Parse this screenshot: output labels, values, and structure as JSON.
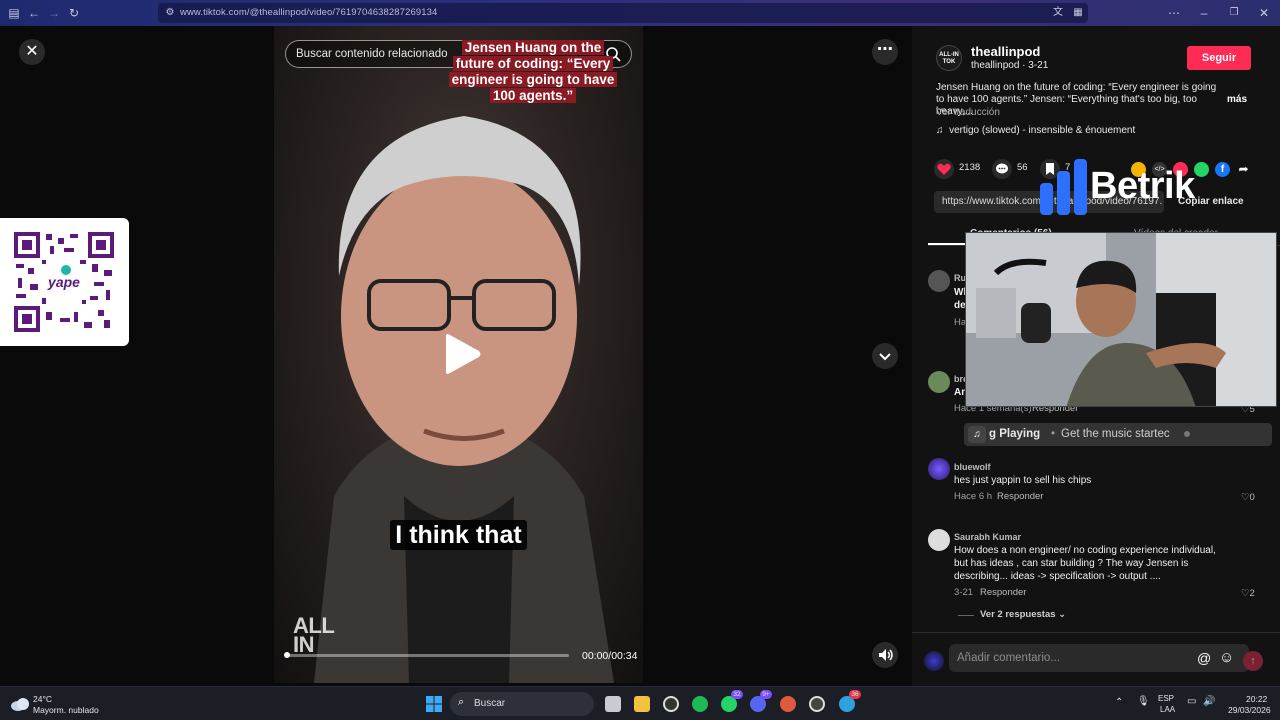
{
  "browser": {
    "url": "www.tiktok.com/@theallinpod/video/7619704638287269134"
  },
  "video": {
    "search_placeholder": "Buscar contenido relacionado",
    "top_caption": "Jensen Huang on the future of coding: “Every engineer is going to have 100 agents.”",
    "subtitle": "I think that",
    "watermark_line1": "ALL",
    "watermark_line2": "IN",
    "time": "00:00/00:34",
    "progress_fraction": 0.0
  },
  "author": {
    "avatar_line1": "ALL-IN",
    "avatar_line2": "TOK",
    "name": "theallinpod",
    "meta": "theallinpod · 3-21",
    "follow_label": "Seguir"
  },
  "description": {
    "text": "Jensen Huang on the future of coding: “Every engineer is going to have 100 agents.” Jensen: “Everything that's too big, too heavy,...",
    "more_label": "más",
    "translate_label": "Ver traducción",
    "music": "vertigo (slowed) - insensible & énouement"
  },
  "stats": {
    "likes": "2138",
    "comments": "56",
    "saves": "7"
  },
  "link": {
    "url": "https://www.tiktok.com/@theallinpod/video/76197...",
    "copy_label": "Copiar enlace"
  },
  "overlay": {
    "brand": "Betrik",
    "music_toast_prefix": "g Playing",
    "music_toast_text": "Get the music startec"
  },
  "tabs": {
    "comments": "Comentarios (56)",
    "creator": "Vídeos del creador"
  },
  "comments": [
    {
      "user": "Ru",
      "text": "Wh",
      "text2": "de",
      "meta": "Ha",
      "likes": ""
    },
    {
      "user": "bre",
      "text": "An",
      "meta": "Hace 1 semana(s)",
      "reply": "Responder",
      "likes": "5"
    },
    {
      "user": "bluewolf",
      "text": "hes just yappin to sell his chips",
      "meta": "Hace 6 h",
      "reply": "Responder",
      "likes": "0"
    },
    {
      "user": "Saurabh Kumar",
      "text": "How does a non engineer/ no coding experience individual, but has ideas , can star building ? The way Jensen is describing... ideas -> specification -> output ....",
      "meta": "3-21",
      "reply": "Responder",
      "likes": "2"
    }
  ],
  "replies_label": "Ver 2 respuestas",
  "compose_placeholder": "Añadir comentario...",
  "taskbar": {
    "weather_temp": "24°C",
    "weather_desc": "Mayorm. nublado",
    "search_label": "Buscar",
    "lang_line1": "ESP",
    "lang_line2": "LAA",
    "time": "20:22",
    "date": "29/03/2026",
    "badge_whatsapp": "32",
    "badge_discord": "9+",
    "badge_telegram": "36"
  },
  "colors": {
    "follow": "#fe2c55",
    "panel_bg": "#121212",
    "caption_bg": "#8a1a24",
    "browser_header": "#2b2f7e"
  }
}
